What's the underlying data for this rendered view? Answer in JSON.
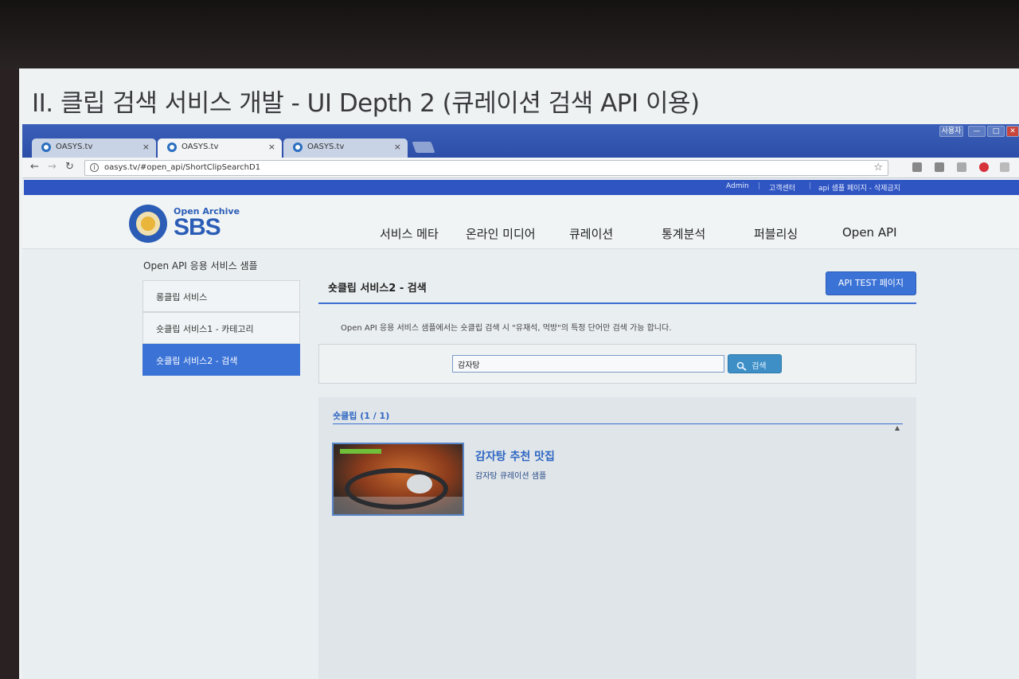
{
  "slide": {
    "title": "II. 클립 검색 서비스 개발 - UI Depth 2 (큐레이션 검색 API 이용)"
  },
  "browser": {
    "tabs": [
      {
        "label": "OASYS.tv"
      },
      {
        "label": "OASYS.tv"
      },
      {
        "label": "OASYS.tv"
      }
    ],
    "tab_close": "×",
    "url": "oasys.tv/#open_api/ShortClipSearchD1",
    "window_controls": [
      "사용자",
      "—",
      "□",
      "✕"
    ]
  },
  "topbar": {
    "links": [
      "Admin",
      "고객센터",
      "api 샘플 페이지 - 삭제금지"
    ],
    "color": "#2f55c2"
  },
  "header": {
    "logo_sub": "Open Archive",
    "logo_main": "SBS",
    "nav": [
      "서비스 메타",
      "온라인 미디어",
      "큐레이션",
      "통계분석",
      "퍼블리싱",
      "Open API"
    ]
  },
  "sidebar": {
    "title": "Open API 응용 서비스 샘플",
    "items": [
      {
        "label": "롱클립 서비스"
      },
      {
        "label": "숏클립 서비스1 - 카테고리"
      },
      {
        "label": "숏클립 서비스2 - 검색"
      }
    ],
    "active_color": "#3a72d6"
  },
  "panel": {
    "title": "숏클립 서비스2 - 검색",
    "api_button": "API TEST 페이지",
    "notice": "Open API 응용 서비스 샘플에서는 숏클립 검색 시 \"유재석, 먹방\"의 특정 단어만 검색 가능 합니다.",
    "search": {
      "value": "감자탕",
      "button": "검색"
    },
    "results": {
      "header": "숏클립 (1 / 1)",
      "items": [
        {
          "title": "감자탕 추천 맛집",
          "description": "감자탕 큐레이션 샘플"
        }
      ]
    }
  }
}
